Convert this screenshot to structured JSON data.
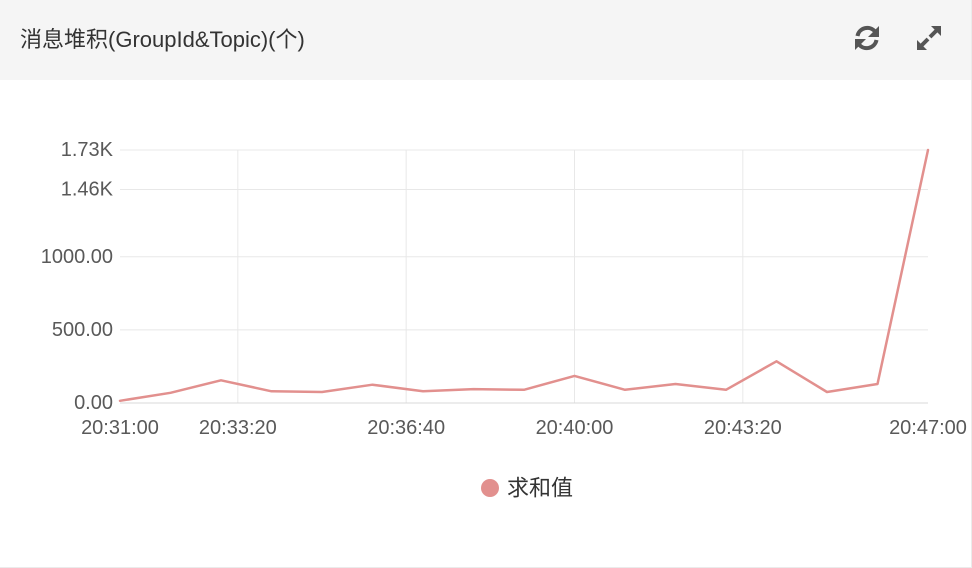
{
  "header": {
    "refresh_icon": "refresh-icon",
    "expand_icon": "expand-icon"
  },
  "theme": {
    "header_background": "#f5f5f5",
    "icon_color": "#555555",
    "grid_color": "#e8e8e8",
    "axis_color": "#d9d9d9",
    "tick_label_color": "#595959",
    "legend_text_color": "#333333"
  },
  "chart_data": {
    "type": "line",
    "title": "消息堆积(GroupId&Topic)(个)",
    "x": [
      "20:31:00",
      "20:32:00",
      "20:33:00",
      "20:34:00",
      "20:35:00",
      "20:36:00",
      "20:37:00",
      "20:38:00",
      "20:39:00",
      "20:40:00",
      "20:41:00",
      "20:42:00",
      "20:43:00",
      "20:44:00",
      "20:45:00",
      "20:46:00",
      "20:47:00"
    ],
    "xlim": [
      "20:31:00",
      "20:47:00"
    ],
    "ylim": [
      0,
      1730
    ],
    "x_ticks": [
      "20:31:00",
      "20:33:20",
      "20:36:40",
      "20:40:00",
      "20:43:20",
      "20:47:00"
    ],
    "y_ticks": [
      {
        "value": 0,
        "label": "0.00"
      },
      {
        "value": 500,
        "label": "500.00"
      },
      {
        "value": 1000,
        "label": "1000.00"
      },
      {
        "value": 1460,
        "label": "1.46K"
      },
      {
        "value": 1730,
        "label": "1.73K"
      }
    ],
    "series": [
      {
        "name": "求和值",
        "color": "#e2908e",
        "values": [
          15,
          70,
          155,
          80,
          75,
          125,
          80,
          95,
          90,
          185,
          90,
          130,
          90,
          285,
          75,
          130,
          1730
        ]
      }
    ],
    "grid": true,
    "legend": "bottom-center"
  }
}
